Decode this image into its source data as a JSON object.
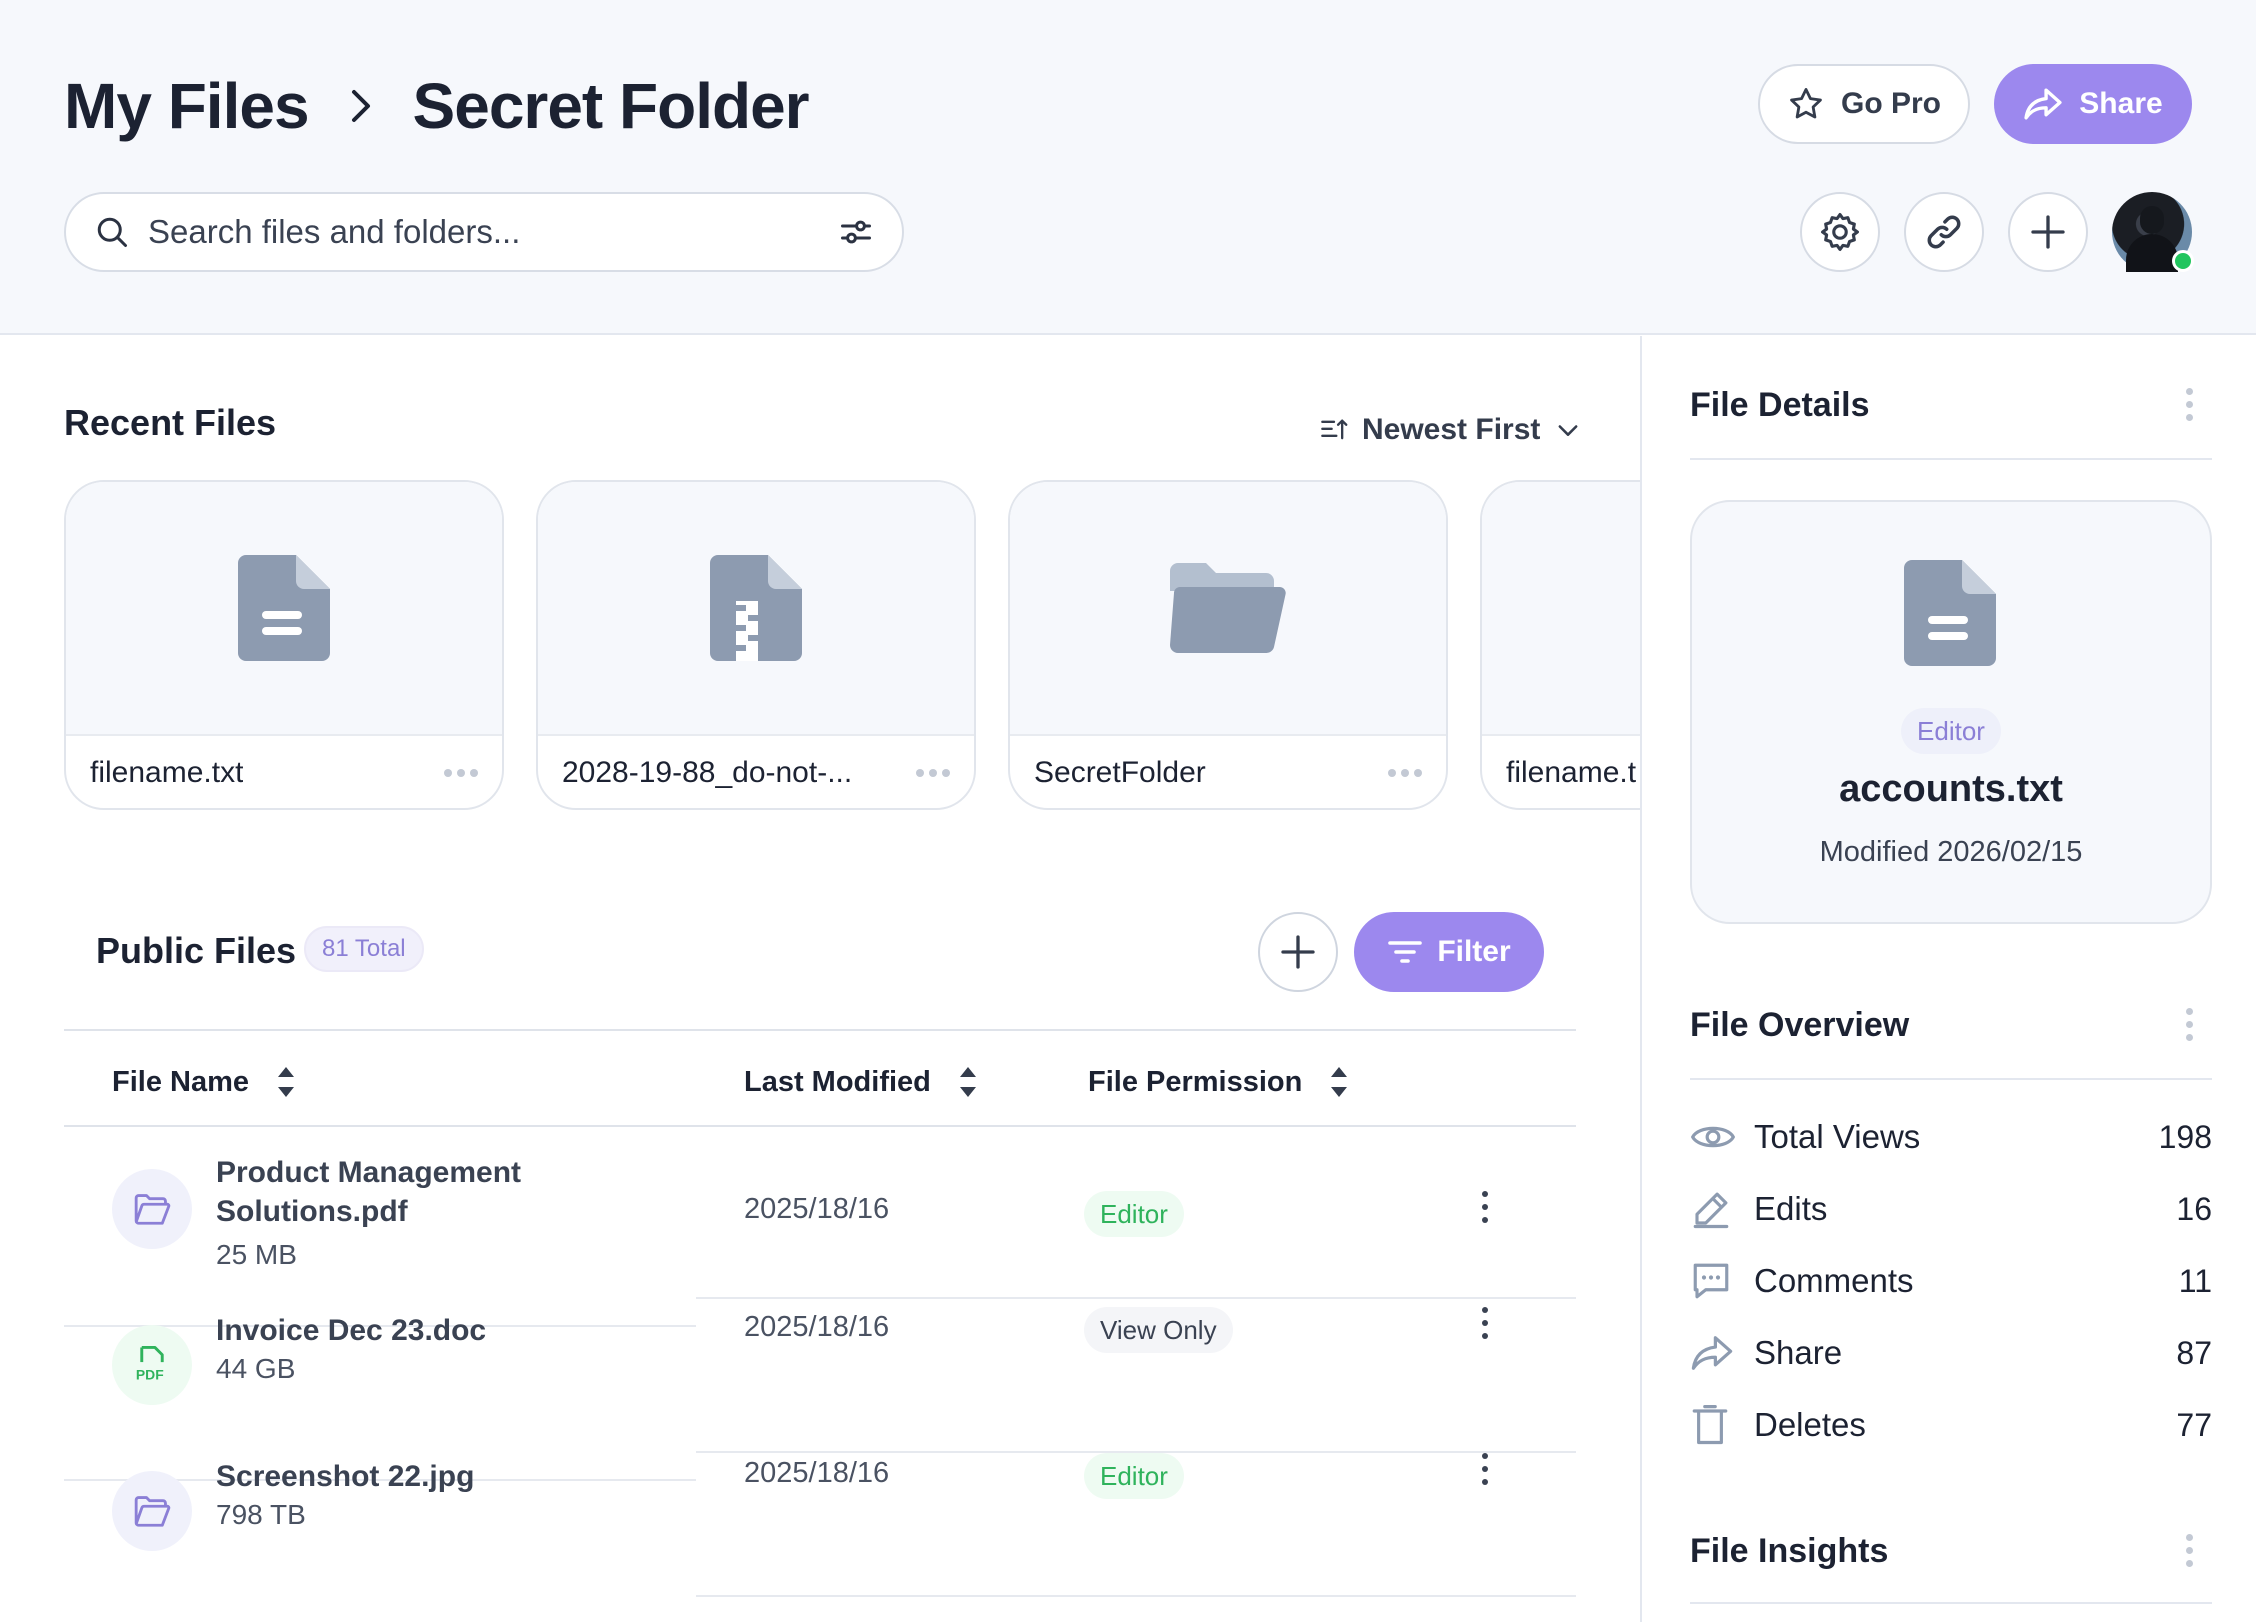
{
  "breadcrumb": {
    "root": "My Files",
    "current": "Secret Folder"
  },
  "header_actions": {
    "gopro_label": "Go Pro",
    "share_label": "Share"
  },
  "search": {
    "placeholder": "Search files and folders..."
  },
  "toolbar_icons": [
    "gear-icon",
    "link-icon",
    "plus-icon"
  ],
  "recent": {
    "title": "Recent Files",
    "sort_label": "Newest First",
    "cards": [
      {
        "name": "filename.txt",
        "icon": "document-icon"
      },
      {
        "name": "2028-19-88_do-not-...",
        "icon": "zip-icon"
      },
      {
        "name": "SecretFolder",
        "icon": "folder-icon"
      },
      {
        "name": "filename.t",
        "icon": "document-icon"
      }
    ]
  },
  "public": {
    "title": "Public Files",
    "count": "81 Total",
    "filter_label": "Filter",
    "columns": [
      "File Name",
      "Last Modified",
      "File Permission"
    ],
    "rows": [
      {
        "name_line1": "Product Management",
        "name_line2": "Solutions.pdf",
        "size": "25 MB",
        "date": "2025/18/16",
        "permission": "Editor",
        "icon": "folder-icon"
      },
      {
        "name_line1": "Invoice Dec 23.doc",
        "size": "44 GB",
        "date": "2025/18/16",
        "permission": "View Only",
        "icon": "pdf-icon"
      },
      {
        "name_line1": "Screenshot 22.jpg",
        "size": "798 TB",
        "date": "2025/18/16",
        "permission": "Editor",
        "icon": "folder-icon"
      }
    ]
  },
  "details": {
    "title": "File Details",
    "role": "Editor",
    "file_name": "accounts.txt",
    "modified": "Modified 2026/02/15"
  },
  "overview": {
    "title": "File Overview",
    "stats": [
      {
        "label": "Total Views",
        "value": "198",
        "icon": "eye-icon"
      },
      {
        "label": "Edits",
        "value": "16",
        "icon": "pencil-icon"
      },
      {
        "label": "Comments",
        "value": "11",
        "icon": "comment-icon"
      },
      {
        "label": "Share",
        "value": "87",
        "icon": "share-icon"
      },
      {
        "label": "Deletes",
        "value": "77",
        "icon": "trash-icon"
      }
    ]
  },
  "insights": {
    "title": "File Insights"
  },
  "colors": {
    "accent": "#9c88ee",
    "editor_green": "#2fb35c",
    "status_online": "#22c55e",
    "icon_slate": "#8d9bb0"
  }
}
